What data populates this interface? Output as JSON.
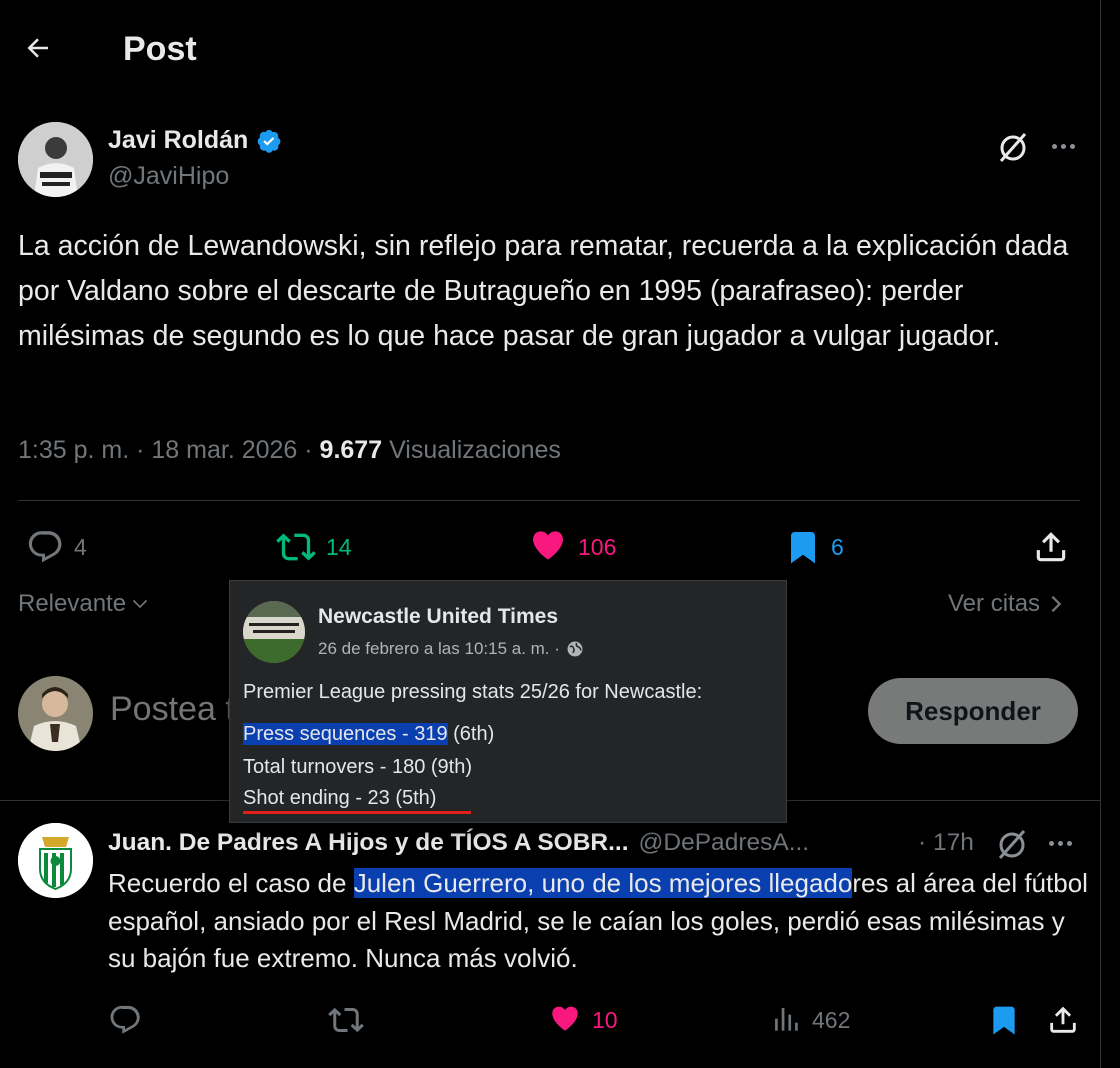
{
  "header": {
    "title": "Post"
  },
  "post": {
    "author_name": "Javi Roldán",
    "author_handle": "@JaviHipo",
    "text": "La acción de Lewandowski, sin reflejo para rematar, recuerda a la explicación dada por Valdano sobre el descarte de Butragueño en 1995 (parafraseo): perder milésimas de segundo es lo que hace pasar de gran jugador a vulgar jugador.",
    "time": "1:35 p. m.",
    "date": "18 mar. 2026",
    "views_count": "9.677",
    "views_label": "Visualizaciones",
    "replies": "4",
    "retweets": "14",
    "likes": "106",
    "bookmarks": "6"
  },
  "sort": {
    "label": "Relevante",
    "quotes_label": "Ver citas"
  },
  "compose": {
    "placeholder": "Postea tu respuesta",
    "reply_button": "Responder"
  },
  "reply": {
    "author_name": "Juan. De Padres A Hijos y de TÍOS A SOBR...",
    "author_handle": "@DePadresA...",
    "time": "· 17h",
    "text_before": "Recuerdo el caso de ",
    "text_highlight": "Julen Guerrero, uno de los mejores llegado",
    "text_after": "res al área del fútbol español, ansiado por el Resl Madrid, se le caían los goles, perdió esas milésimas y su bajón fue extremo. Nunca más volvió.",
    "likes": "10",
    "views": "462"
  },
  "popup": {
    "page_name": "Newcastle United Times",
    "date": "26 de febrero a las 10:15 a. m. ·",
    "intro": "Premier League pressing stats 25/26 for Newcastle:",
    "stats": [
      {
        "highlight": "Press sequences - 319",
        "rest": " (6th)"
      },
      {
        "highlight": "",
        "rest": "Total turnovers - 180 (9th)"
      },
      {
        "highlight": "",
        "rest": "Shot ending - 23 (5th)"
      }
    ]
  },
  "colors": {
    "background": "#000000",
    "retweet_green": "#00ba7c",
    "like_pink": "#f91880",
    "bookmark_blue": "#1d9bf0",
    "highlight_blue": "#0a3fb0",
    "underline_red": "#e0201a"
  },
  "icons": [
    "back-arrow-icon",
    "verified-badge-icon",
    "grok-icon",
    "more-icon",
    "reply-icon",
    "retweet-icon",
    "heart-icon",
    "bookmark-icon",
    "share-icon",
    "chevron-down-icon",
    "chevron-right-icon",
    "globe-icon",
    "views-icon"
  ]
}
